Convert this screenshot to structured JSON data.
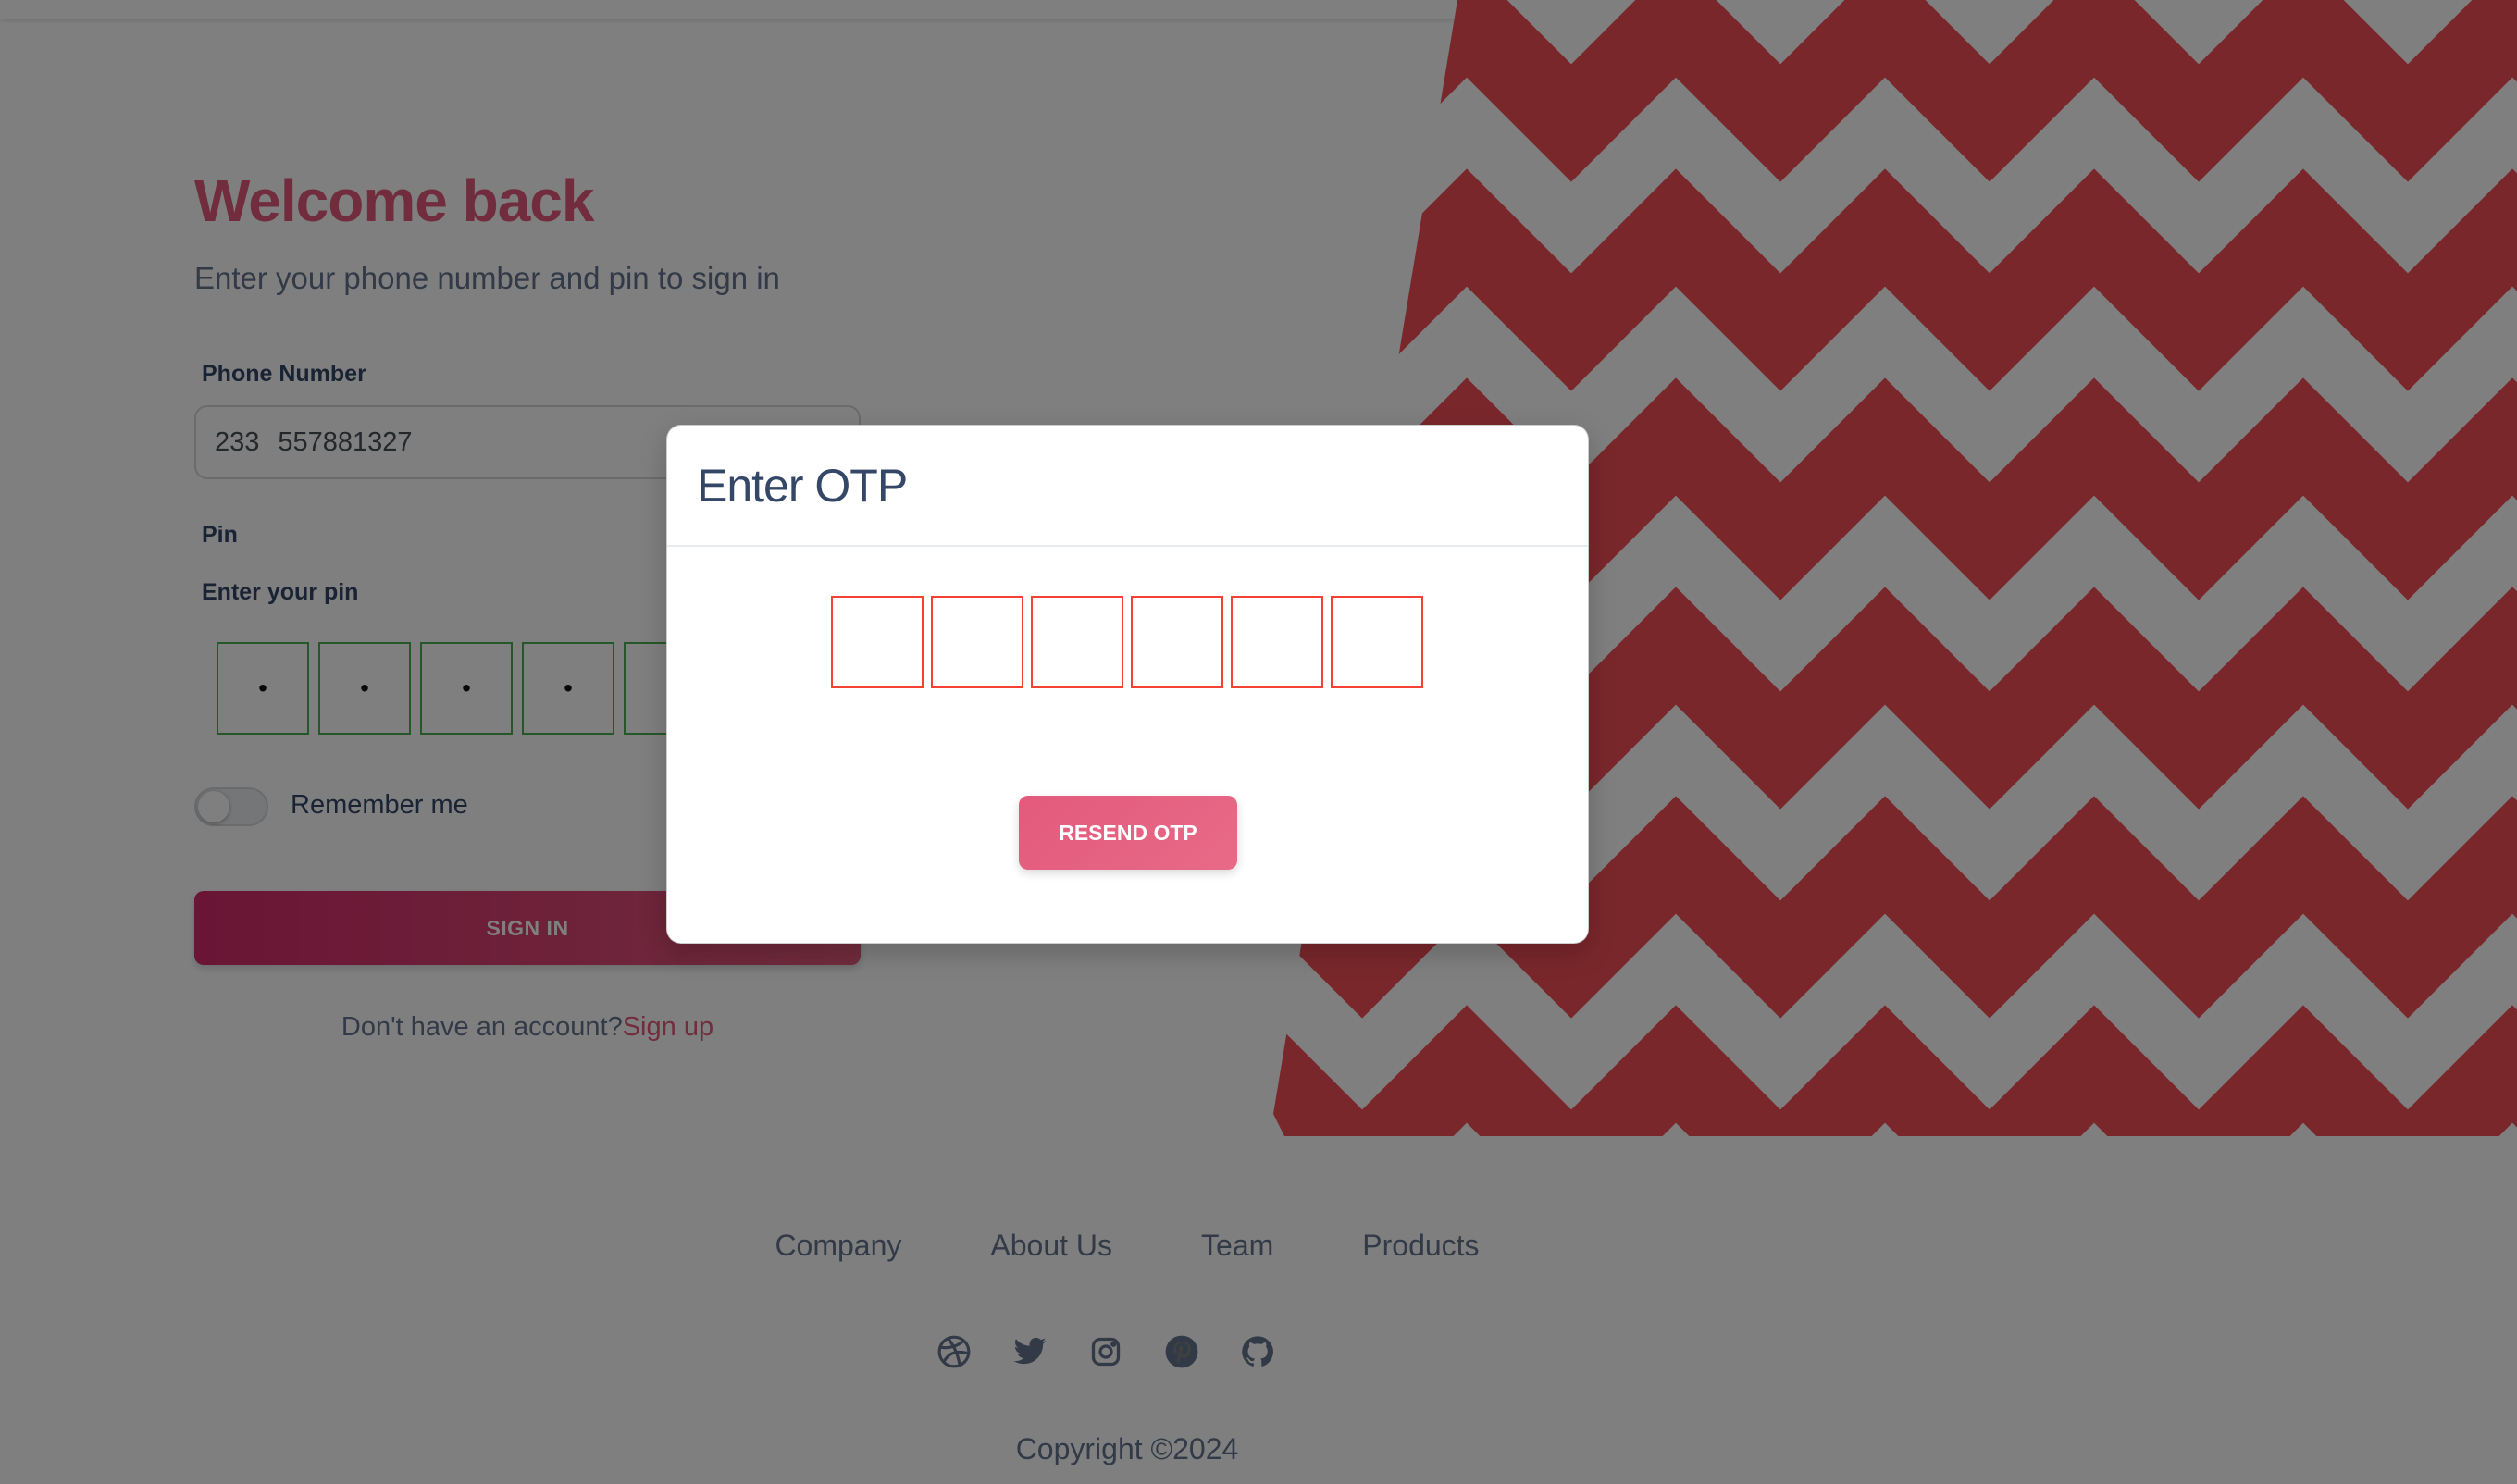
{
  "login": {
    "title": "Welcome back",
    "subtitle": "Enter your phone number and pin to sign in",
    "phone_label": "Phone Number",
    "phone_code": "233",
    "phone_number": "557881327",
    "pin_label": "Pin",
    "pin_sublabel": "Enter your pin",
    "pin_digits": [
      "•",
      "•",
      "•",
      "•",
      "•"
    ],
    "remember_label": "Remember me",
    "remember_on": false,
    "signin_label": "SIGN IN",
    "no_account_text": "Don't have an account?",
    "signup_link": "Sign up"
  },
  "otp_modal": {
    "title": "Enter OTP",
    "otp_values": [
      "",
      "",
      "",
      "",
      "",
      ""
    ],
    "resend_label": "RESEND OTP"
  },
  "footer": {
    "links": [
      "Company",
      "About Us",
      "Team",
      "Products"
    ],
    "social_icons": [
      "dribbble-icon",
      "twitter-icon",
      "instagram-icon",
      "pinterest-icon",
      "github-icon"
    ],
    "copyright": "Copyright ©2024"
  },
  "colors": {
    "brand": "#e35a7c",
    "pattern_red": "#f44f57",
    "pin_border": "#4caf50",
    "otp_border": "#f44335"
  }
}
